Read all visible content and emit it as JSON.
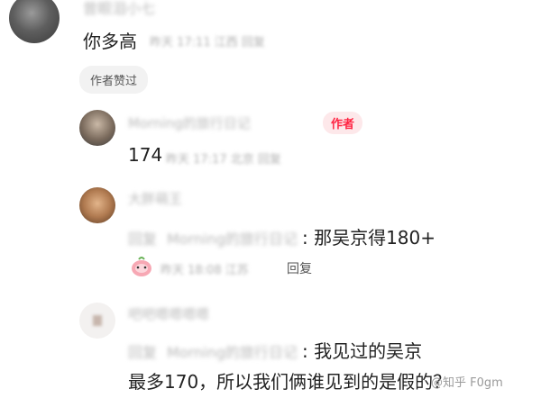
{
  "comment1": {
    "username": "曾眼泪小七",
    "text": "你多高",
    "meta": "昨天 17:11 江西 回复",
    "liked_tag": "作者赞过"
  },
  "reply1": {
    "username": "Morning的旅行日记",
    "author_badge": "作者",
    "text": "174",
    "meta": "昨天 17:17 北京 回复"
  },
  "reply2": {
    "username": "大胖萌王",
    "reply_prefix": "回复",
    "reply_target": "Morning的旅行日记",
    "text": ": 那吴京得180+",
    "meta": "昨天 18:08 江苏",
    "reply_label": "回复"
  },
  "reply3": {
    "username": "吧吧嗯嗯嗯嗯",
    "reply_prefix": "回复",
    "reply_target": "Morning的旅行日记",
    "text_line1": ": 我见过的吴京",
    "text_line2": "最多170，所以我们俩谁见到的是假的？"
  },
  "watermark": "@知乎 F0gm"
}
